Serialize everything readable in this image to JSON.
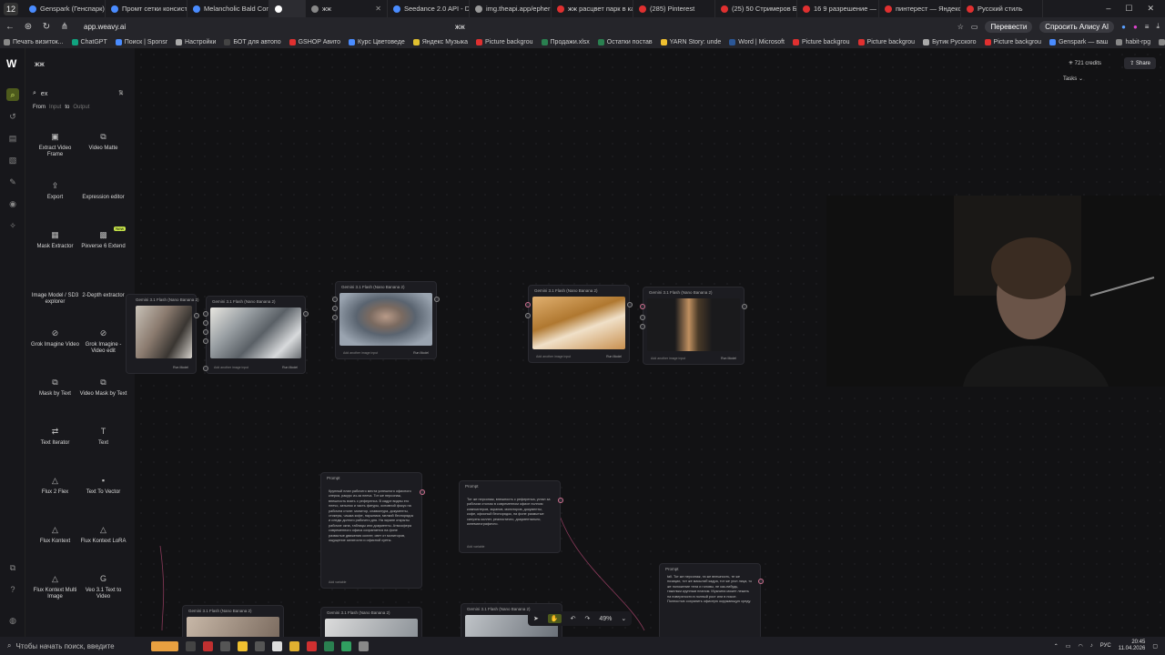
{
  "browser": {
    "tab_count": "12",
    "tabs": [
      {
        "title": "Genspark (Генспарк)",
        "color": "#4a8cff"
      },
      {
        "title": "Промт сетки консист",
        "color": "#4a8cff"
      },
      {
        "title": "Melancholic Bald Corp",
        "color": "#4a8cff"
      },
      {
        "title": "",
        "color": "#ffffff",
        "active": true
      },
      {
        "title": "жж",
        "color": "#888888"
      },
      {
        "title": "Seedance 2.0 API - Do",
        "color": "#4a8cff"
      },
      {
        "title": "img.theapi.app/epherr",
        "color": "#999999"
      },
      {
        "title": "жж расцвет парк в ка",
        "color": "#e03030"
      },
      {
        "title": "(285) Pinterest",
        "color": "#e03030"
      },
      {
        "title": "(25) 50 Стримеров Бо",
        "color": "#e03030"
      },
      {
        "title": "16 9 разрешение — Я",
        "color": "#e03030"
      },
      {
        "title": "пинтерест — Яндекс",
        "color": "#e03030"
      },
      {
        "title": "Русский стиль",
        "color": "#e03030"
      }
    ],
    "url": "app.weavy.ai",
    "page_title": "жж",
    "translate_btn": "Перевести",
    "alice_btn": "Спросить Алису AI",
    "bookmarks": [
      "Печать визиток...",
      "ChatGPT",
      "Поиск | Sponsr",
      "Настройки",
      "БОТ для автопо",
      "GSHOP Авито",
      "Курс Цветоведе",
      "Яндекс Музыка",
      "Picture backgrou",
      "Продажи.xlsx",
      "Остатки постав",
      "YARN Story: unde",
      "Word | Microsoft",
      "Picture backgrou",
      "Picture backgrou",
      "Бутик Русского",
      "Picture backgrou",
      "Genspark — ваш",
      "habit-rpg",
      "Wan2"
    ]
  },
  "app": {
    "project_name": "жж",
    "search_value": "ex",
    "from_label": "From",
    "input_label": "Input",
    "to_label": "to",
    "output_label": "Output",
    "tools": [
      {
        "icon": "▣",
        "label": "Extract Video Frame"
      },
      {
        "icon": "⧉",
        "label": "Video Matte"
      },
      {
        "icon": "⇪",
        "label": "Export"
      },
      {
        "icon": "",
        "label": "Expression editor"
      },
      {
        "icon": "▦",
        "label": "Mask Extractor"
      },
      {
        "icon": "▩",
        "label": "Pixverse 6 Extend",
        "badge": "New"
      },
      {
        "icon": "",
        "label": "Image Model / SD3 explorer"
      },
      {
        "icon": "",
        "label": "2-Depth extractor"
      },
      {
        "icon": "⊘",
        "label": "Grok Imagine Video"
      },
      {
        "icon": "⊘",
        "label": "Grok Imagine - Video edit"
      },
      {
        "icon": "⧉",
        "label": "Mask by Text"
      },
      {
        "icon": "⧉",
        "label": "Video Mask by Text"
      },
      {
        "icon": "⇄",
        "label": "Text Iterator"
      },
      {
        "icon": "T",
        "label": "Text"
      },
      {
        "icon": "△",
        "label": "Flux 2 Flex"
      },
      {
        "icon": "▪",
        "label": "Text To Vector"
      },
      {
        "icon": "△",
        "label": "Flux Kontext"
      },
      {
        "icon": "△",
        "label": "Flux Kontext LoRA"
      },
      {
        "icon": "△",
        "label": "Flux Kontext Multi Image"
      },
      {
        "icon": "G",
        "label": "Veo 3.1 Text to Video"
      }
    ],
    "credits": "721 credits",
    "share": "Share",
    "tasks": "Tasks",
    "zoom": "49%",
    "nodes": {
      "n1_title": "Gemini 3.1 Flash (Nano Banana 2)",
      "n2_title": "Gemini 3.1 Flash (Nano Banana 2)",
      "n3_title": "Gemini 3.1 Flash (Nano Banana 2)",
      "n4_title": "Gemini 3.1 Flash (Nano Banana 2)",
      "n5_title": "Gemini 3.1 Flash (Nano Banana 2)",
      "add_input": "Add another image input",
      "run": "Run Model",
      "prompt_label": "Prompt",
      "add_variable": "Add variable",
      "prompt1": "Крупный план рабочего места успешного офисного клерка, ракурс из-за плеча. Тот же персонаж, внешность взять с референса. В кадре видны его плечо, затылок и часть фигуры, основной фокус на рабочем столе: монитор, клавиатура, документы, стикеры, чашка кофе, наушники, мелкий беспорядок и следы долгого рабочего дня. На экране открыты рабочие окна, таблицы или документы. Атмосфера современного офиса сохраняется на фоне размытые движения коллег, свет от мониторов, ощущение занятости и офисной суеты.",
      "prompt2": "Тот же персонаж, внешность с референса, устал за рабочим столом в современном офисе полном компьютеров, экранов, мониторов, документы, кофе, офисный беспорядок, на фоне размытые силуэты коллег, реалистично, документально, кинематографично.",
      "prompt3": "tall. Тот же персонаж, та же внешность, те же позиции, тот же масштаб кадра, тот же угол лица, то же положение тела и головы, не как-нибудь, тяжелым крупным планом. Мужчина может лежать на поверхности в полный рост или в покое. Полностью сохранить офисную окружающую среду."
    }
  },
  "taskbar": {
    "search_placeholder": "Чтобы начать поиск, введите",
    "lang": "РУС",
    "time": "20:45",
    "date": "11.04.2026"
  }
}
